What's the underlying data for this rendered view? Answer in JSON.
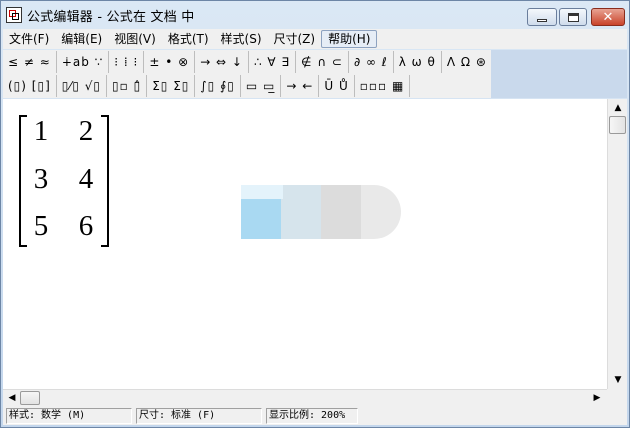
{
  "window": {
    "title": "公式编辑器 - 公式在 文档 中",
    "close_glyph": "✕"
  },
  "menu": [
    {
      "label": "文件(F)"
    },
    {
      "label": "编辑(E)"
    },
    {
      "label": "视图(V)"
    },
    {
      "label": "格式(T)"
    },
    {
      "label": "样式(S)"
    },
    {
      "label": "尺寸(Z)"
    },
    {
      "label": "帮助(H)",
      "active": true
    }
  ],
  "toolbar_row1": [
    "≤ ≠ ≈",
    "∔ab ∵",
    "⁝ ⁞ ⁝",
    "± • ⊗",
    "→ ⇔ ↓",
    "∴ ∀ ∃",
    "∉ ∩ ⊂",
    "∂ ∞ ℓ",
    "λ ω θ",
    "Λ Ω ⊛"
  ],
  "toolbar_row2": [
    "(▯) [▯]",
    "▯⁄▯ √▯",
    "▯▫ ▯̂",
    "Σ▯ Σ▯",
    "∫▯ ∮▯",
    "▭ ▭̲",
    "→ ←",
    "Ū Ů",
    "▫▫▫ ▦"
  ],
  "matrix": {
    "rows": [
      [
        "1",
        "2"
      ],
      [
        "3",
        "4"
      ],
      [
        "5",
        "6"
      ]
    ]
  },
  "scroll": {
    "up": "▲",
    "down": "▼",
    "left": "◀",
    "right": "▶"
  },
  "status": {
    "style": "样式: 数学 (M)",
    "size": "尺寸: 标准 (F)",
    "zoom": "显示比例: 200%"
  }
}
